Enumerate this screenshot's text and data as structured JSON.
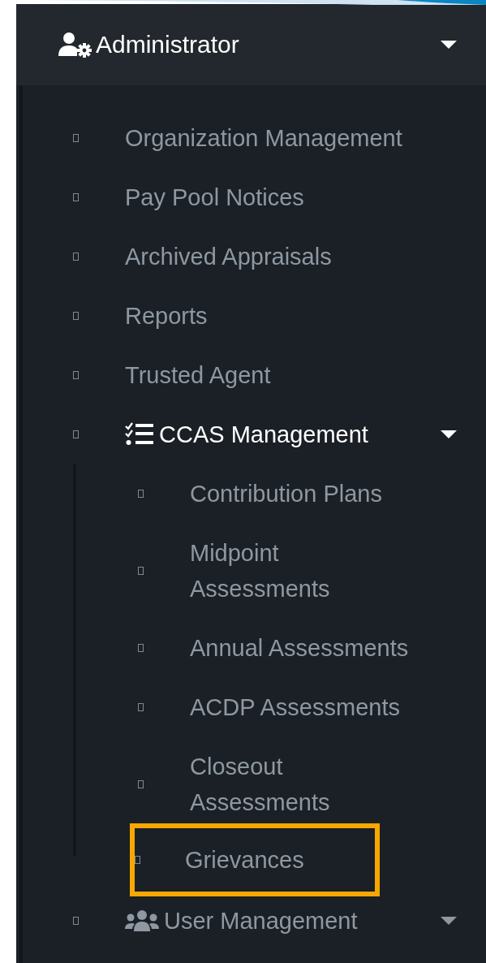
{
  "menu": {
    "label": "Administrator",
    "expanded": true,
    "items": [
      {
        "label": "Organization Management",
        "kind": "link",
        "active": false
      },
      {
        "label": "Pay Pool Notices",
        "kind": "link",
        "active": false
      },
      {
        "label": "Archived Appraisals",
        "kind": "link",
        "active": false
      },
      {
        "label": "Reports",
        "kind": "link",
        "active": false
      },
      {
        "label": "Trusted Agent",
        "kind": "link",
        "active": false
      },
      {
        "label": "CCAS Management",
        "kind": "group",
        "active": true,
        "expanded": true,
        "children": [
          {
            "label": "Contribution Plans",
            "highlighted": false
          },
          {
            "label": "Midpoint Assessments",
            "highlighted": false
          },
          {
            "label": "Annual Assessments",
            "highlighted": false
          },
          {
            "label": "ACDP Assessments",
            "highlighted": false
          },
          {
            "label": "Closeout Assessments",
            "highlighted": false
          },
          {
            "label": "Grievances",
            "highlighted": true
          }
        ]
      },
      {
        "label": "User Management",
        "kind": "group",
        "active": false
      }
    ]
  }
}
